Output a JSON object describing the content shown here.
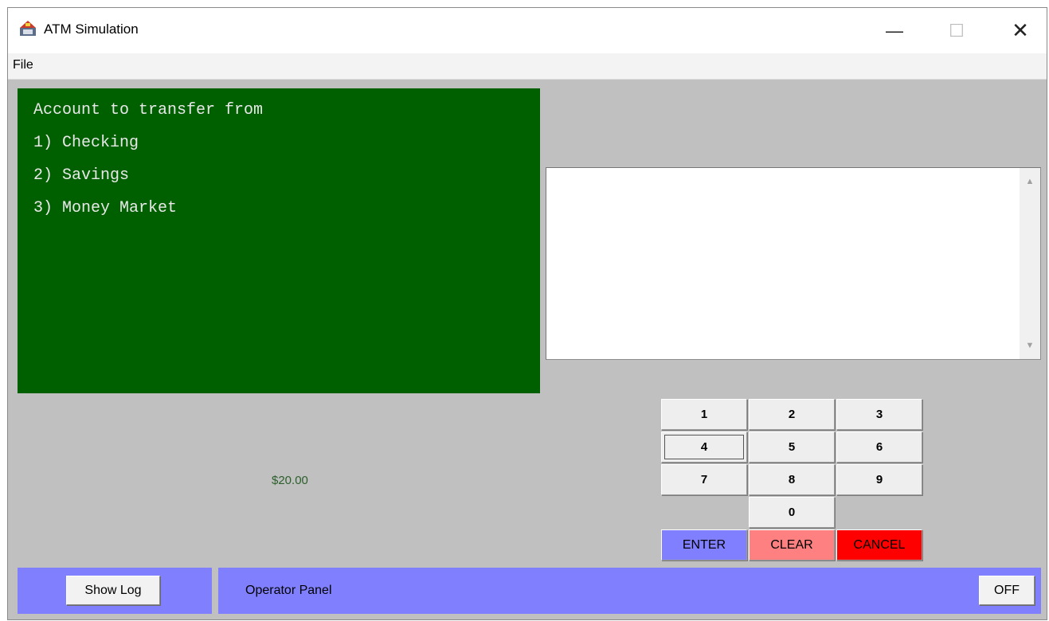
{
  "window": {
    "title": "ATM Simulation",
    "icon": "atm-app-icon",
    "controls": {
      "minimize": "—",
      "maximize": "☐",
      "close": "✕"
    }
  },
  "menubar": {
    "items": [
      {
        "label": "File"
      }
    ]
  },
  "screen": {
    "background": "#006000",
    "lines": [
      "Account to transfer from",
      "1) Checking",
      "2) Savings",
      "3) Money Market"
    ]
  },
  "log": {
    "text": ""
  },
  "cash": {
    "amount": "$20.00"
  },
  "keypad": {
    "digits": [
      "1",
      "2",
      "3",
      "4",
      "5",
      "6",
      "7",
      "8",
      "9",
      "0"
    ],
    "enter": "ENTER",
    "clear": "CLEAR",
    "cancel": "CANCEL",
    "colors": {
      "enter": "#7f7fff",
      "clear": "#ff8080",
      "cancel": "#ff0000"
    }
  },
  "operator": {
    "show_log": "Show Log",
    "panel_label": "Operator Panel",
    "power": "OFF",
    "panel_color": "#8080ff"
  }
}
